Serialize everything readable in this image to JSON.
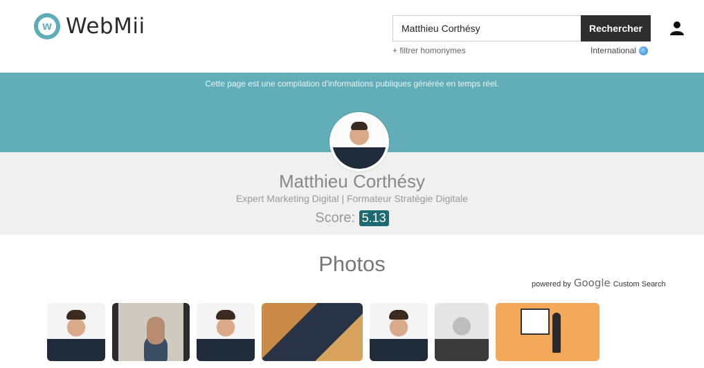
{
  "brand": {
    "name": "WebMii",
    "logo_letter": "w"
  },
  "search": {
    "value": "Matthieu Corthésy",
    "button_label": "Rechercher"
  },
  "filter_link": "+ filtrer homonymes",
  "region": "International",
  "band_note": "Cette page est une compilation d'informations publiques générée en temps réel.",
  "profile": {
    "name": "Matthieu Corthésy",
    "headline": "Expert Marketing Digital | Formateur Stratégie Digitale",
    "score_label": "Score:",
    "score_value": "5.13"
  },
  "photos": {
    "heading": "Photos",
    "powered_prefix": "powered by",
    "powered_brand": "Google",
    "powered_suffix": "Custom Search",
    "thumbnails": [
      "portrait",
      "video-still",
      "portrait",
      "office-desk",
      "portrait",
      "grayscale-portrait",
      "illustration"
    ]
  },
  "colors": {
    "accent": "#61aeb9",
    "score_badge": "#1e6a73",
    "button": "#2d2d2d",
    "profile_bg": "#f0f0f0"
  },
  "icons": {
    "logo": "webmii-logo-icon",
    "user": "user-icon",
    "globe": "globe-icon"
  }
}
